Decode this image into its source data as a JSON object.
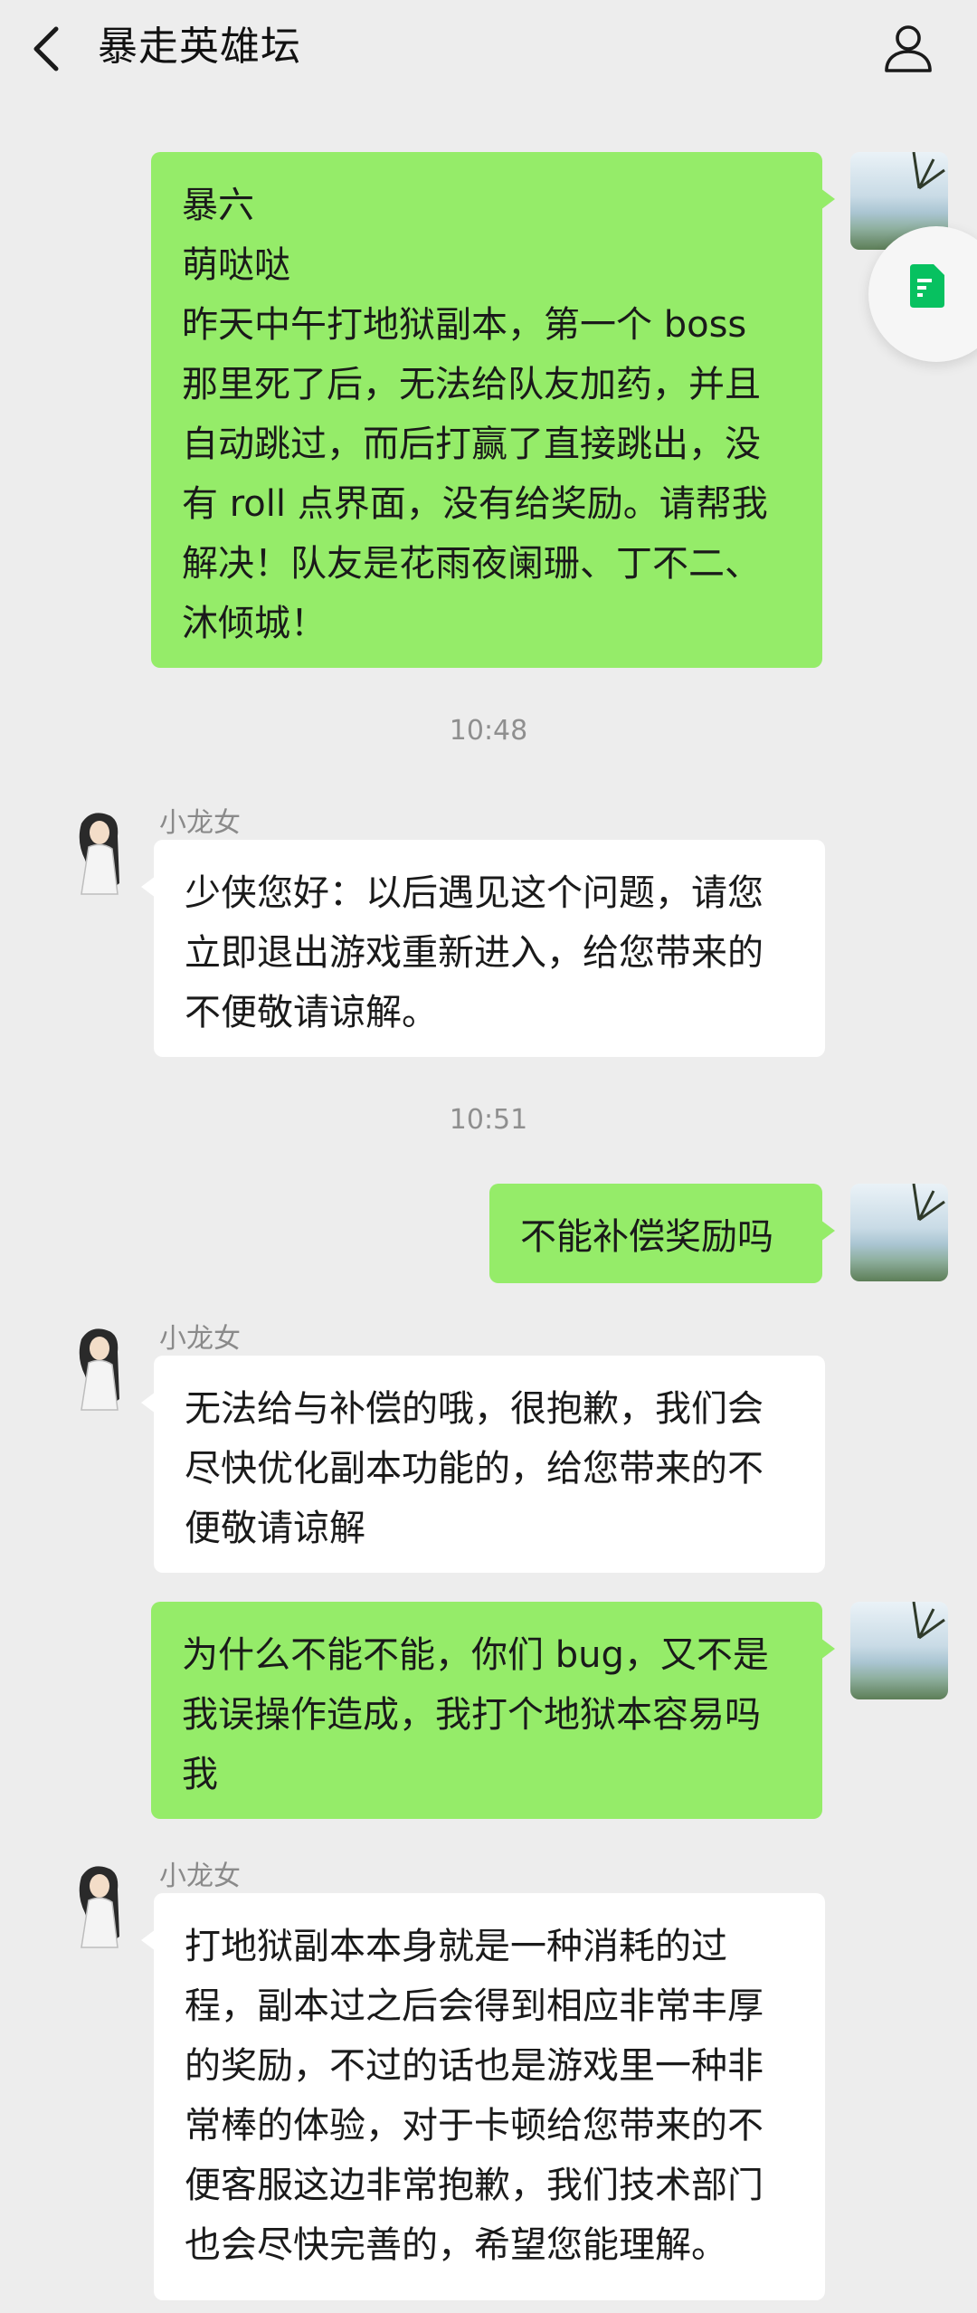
{
  "header": {
    "title": "暴走英雄坛"
  },
  "messages": [
    {
      "lines": [
        "暴六",
        "萌哒哒",
        "昨天中午打地狱副本，第一个 boss",
        "那里死了后，无法给队友加药，并且",
        "自动跳过，而后打赢了直接跳出，没",
        "有 roll 点界面，没有给奖励。请帮我",
        "解决！队友是花雨夜阑珊、丁不二、",
        "沐倾城！"
      ]
    },
    {
      "timestamp": "10:48",
      "sender": "小龙女",
      "lines": [
        "少侠您好：以后遇见这个问题，请您",
        "立即退出游戏重新进入，给您带来的",
        "不便敬请谅解。"
      ]
    },
    {
      "timestamp": "10:51",
      "lines": [
        "不能补偿奖励吗"
      ]
    },
    {
      "sender": "小龙女",
      "lines": [
        "无法给与补偿的哦，很抱歉，我们会",
        "尽快优化副本功能的，给您带来的不",
        "便敬请谅解"
      ]
    },
    {
      "lines": [
        "为什么不能不能，你们 bug，又不是",
        "我误操作造成，我打个地狱本容易吗",
        "我"
      ]
    },
    {
      "sender": "小龙女",
      "lines": [
        "打地狱副本本身就是一种消耗的过",
        "程，副本过之后会得到相应非常丰厚",
        "的奖励，不过的话也是游戏里一种非",
        "常棒的体验，对于卡顿给您带来的不",
        "便客服这边非常抱歉，我们技术部门",
        "也会尽快完善的，希望您能理解。"
      ]
    }
  ],
  "icons": {
    "back": "chevron-left-icon",
    "profile": "person-outline-icon",
    "document": "document-icon"
  },
  "colors": {
    "background": "#ededed",
    "outgoing_bubble": "#95ec69",
    "incoming_bubble": "#ffffff",
    "doc_icon": "#07c160"
  }
}
